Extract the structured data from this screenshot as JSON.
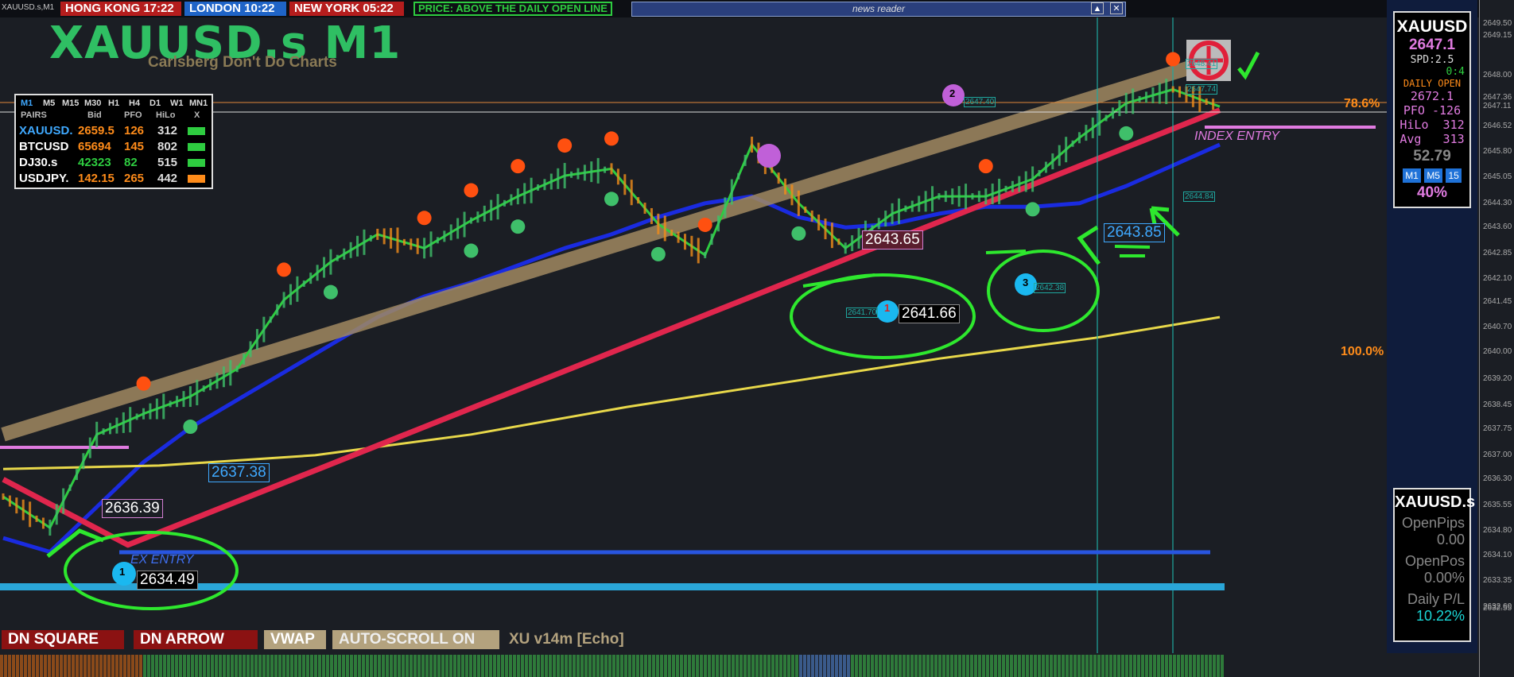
{
  "topbar": {
    "symbol_tab": "XAUUSD.s,M1",
    "clocks": [
      {
        "label": "HONG KONG 17:22",
        "color": "#b51d1d"
      },
      {
        "label": "LONDON  10:22",
        "color": "#1f64c7"
      },
      {
        "label": "NEW YORK 05:22",
        "color": "#b51d1d"
      }
    ],
    "price_status": "PRICE: ABOVE THE DAILY OPEN LINE",
    "news_reader": "news reader"
  },
  "header": {
    "title": "XAUUSD.s M1",
    "subtitle": "Carlsberg Don't Do Charts"
  },
  "pairs_table": {
    "timeframes": [
      "M1",
      "M5",
      "M15",
      "M30",
      "H1",
      "H4",
      "D1",
      "W1",
      "MN1"
    ],
    "columns": [
      "PAIRS",
      "Bid",
      "PFO",
      "HiLo",
      "X"
    ],
    "rows": [
      {
        "pair": "XAUUSD.",
        "bid": "2659.5",
        "pfo": "126",
        "hilo": "312",
        "pair_color": "#3fa9ff",
        "bid_color": "#ff8c1a",
        "box_color": "#2ecc40"
      },
      {
        "pair": "BTCUSD",
        "bid": "65694",
        "pfo": "145",
        "hilo": "802",
        "pair_color": "#ffffff",
        "bid_color": "#ff8c1a",
        "box_color": "#2ecc40"
      },
      {
        "pair": "DJ30.s",
        "bid": "42323",
        "pfo": "82",
        "hilo": "515",
        "pair_color": "#ffffff",
        "bid_color": "#2ecc40",
        "box_color": "#2ecc40"
      },
      {
        "pair": "USDJPY.",
        "bid": "142.15",
        "pfo": "265",
        "hilo": "442",
        "pair_color": "#ffffff",
        "bid_color": "#ff8c1a",
        "box_color": "#ff8c1a"
      }
    ]
  },
  "right_panel": {
    "symbol": "XAUUSD",
    "price": "2647.1",
    "spread": "SPD:2.5",
    "change": "0:4",
    "daily_open_label": "DAILY OPEN",
    "daily_open": "2672.1",
    "pfo": "PFO -126",
    "hilo": "HiLo  312",
    "avg": "Avg   313",
    "value": "52.79",
    "tf_buttons": [
      "M1",
      "M5",
      "15"
    ],
    "percent": "40%"
  },
  "account_panel": {
    "symbol": "XAUUSD.s",
    "open_pips_label": "OpenPips",
    "open_pips": "0.00",
    "open_pos_label": "OpenPos",
    "open_pos": "0.00%",
    "daily_pl_label": "Daily P/L",
    "daily_pl": "10.22%"
  },
  "bottom_buttons": [
    {
      "label": "DN SQUARE",
      "bg": "#8b1212",
      "fg": "#ffffff"
    },
    {
      "label": "DN ARROW",
      "bg": "#8b1212",
      "fg": "#ffffff"
    },
    {
      "label": "VWAP",
      "bg": "#b3a27e",
      "fg": "#ffffff"
    },
    {
      "label": "AUTO-SCROLL ON",
      "bg": "#b3a27e",
      "fg": "#eeeeee"
    },
    {
      "label": "XU v14m [Echo]",
      "bg": "transparent",
      "fg": "#b3a27e"
    }
  ],
  "price_labels": [
    {
      "text": "2636.39",
      "color": "#ffffff",
      "border": "#d27fd2",
      "bg": "#1b1e24"
    },
    {
      "text": "2634.49",
      "color": "#ffffff",
      "border": "#888888",
      "bg": "#000000"
    },
    {
      "text": "2637.38",
      "color": "#3fa9ff",
      "border": "#3fa9ff",
      "bg": "#1b1e24"
    },
    {
      "text": "2643.65",
      "color": "#ffffff",
      "border": "#d27fd2",
      "bg": "#5a1e2e"
    },
    {
      "text": "2641.66",
      "color": "#ffffff",
      "border": "#888888",
      "bg": "#000000"
    },
    {
      "text": "2643.85",
      "color": "#3fa9ff",
      "border": "#3fa9ff",
      "bg": "#1b1e24"
    }
  ],
  "small_labels": [
    "2641.70",
    "2647.40",
    "2642.38",
    "2644.84",
    "2647.74",
    "2648.41"
  ],
  "annotations": {
    "fib_78": "78.6%",
    "fib_100": "100.0%",
    "index_entry": "INDEX ENTRY",
    "ex_entry": "EX ENTRY",
    "pivot_numbers": [
      "1",
      "2",
      "3",
      "1"
    ]
  },
  "colors": {
    "background": "#1b1e24",
    "trend_tan": "#a08860",
    "trend_red": "#e0264d",
    "ma_blue": "#1a2be0",
    "vwap_yellow": "#e8d84a",
    "annotation_green": "#2ee82e"
  },
  "chart_data": {
    "type": "line",
    "title": "XAUUSD.s M1",
    "xlabel": "",
    "ylabel": "",
    "ylim": [
      2632.0,
      2649.5
    ],
    "y_ticks": [
      "2649.50",
      "2649.15",
      "2648.00",
      "2647.36",
      "2647.11",
      "2646.52",
      "2645.80",
      "2645.05",
      "2644.30",
      "2643.60",
      "2642.85",
      "2642.10",
      "2641.45",
      "2640.70",
      "2640.00",
      "2639.20",
      "2638.45",
      "2637.75",
      "2637.00",
      "2636.30",
      "2635.55",
      "2634.80",
      "2634.10",
      "2633.35",
      "2632.60",
      "2632.55"
    ],
    "series": [
      {
        "name": "",
        "color": "#1a2be0",
        "x": [
          0,
          6,
          12,
          18,
          24,
          30,
          36,
          42,
          48,
          54,
          60,
          66,
          72,
          78,
          84,
          90,
          96,
          102,
          108,
          114,
          120,
          126,
          132,
          138,
          144,
          150,
          156
        ],
        "y": [
          2634.6,
          2634.2,
          2635.5,
          2636.8,
          2637.8,
          2638.6,
          2639.4,
          2640.2,
          2641.0,
          2641.6,
          2642.0,
          2642.5,
          2643.0,
          2643.4,
          2643.9,
          2644.3,
          2644.5,
          2643.9,
          2643.6,
          2643.7,
          2644.0,
          2644.2,
          2644.2,
          2644.3,
          2644.8,
          2645.4,
          2646.0
        ]
      },
      {
        "name": "",
        "color": "#e8d84a",
        "x": [
          0,
          20,
          40,
          60,
          80,
          100,
          120,
          140,
          156
        ],
        "y": [
          2636.6,
          2636.7,
          2637.0,
          2637.6,
          2638.4,
          2639.1,
          2639.8,
          2640.4,
          2641.0
        ]
      },
      {
        "name": "",
        "color": "#e0264d",
        "x": [
          0,
          16,
          156
        ],
        "y": [
          2636.3,
          2634.4,
          2647.0
        ]
      },
      {
        "name": "",
        "color": "#a08860",
        "x": [
          0,
          156
        ],
        "y": [
          2637.6,
          2648.5
        ]
      },
      {
        "name": "",
        "color": "#2ecc40",
        "x": [
          0,
          6,
          12,
          18,
          24,
          30,
          36,
          42,
          48,
          54,
          60,
          66,
          72,
          78,
          84,
          90,
          96,
          102,
          108,
          114,
          120,
          126,
          132,
          138,
          144,
          150,
          156
        ],
        "y": [
          2635.8,
          2634.9,
          2637.6,
          2638.2,
          2638.7,
          2639.5,
          2641.5,
          2642.6,
          2643.4,
          2643.0,
          2643.8,
          2644.5,
          2645.1,
          2645.3,
          2643.7,
          2642.8,
          2646.0,
          2644.3,
          2643.0,
          2644.0,
          2644.5,
          2644.5,
          2645.0,
          2646.2,
          2647.2,
          2647.6,
          2647.1
        ]
      }
    ]
  }
}
